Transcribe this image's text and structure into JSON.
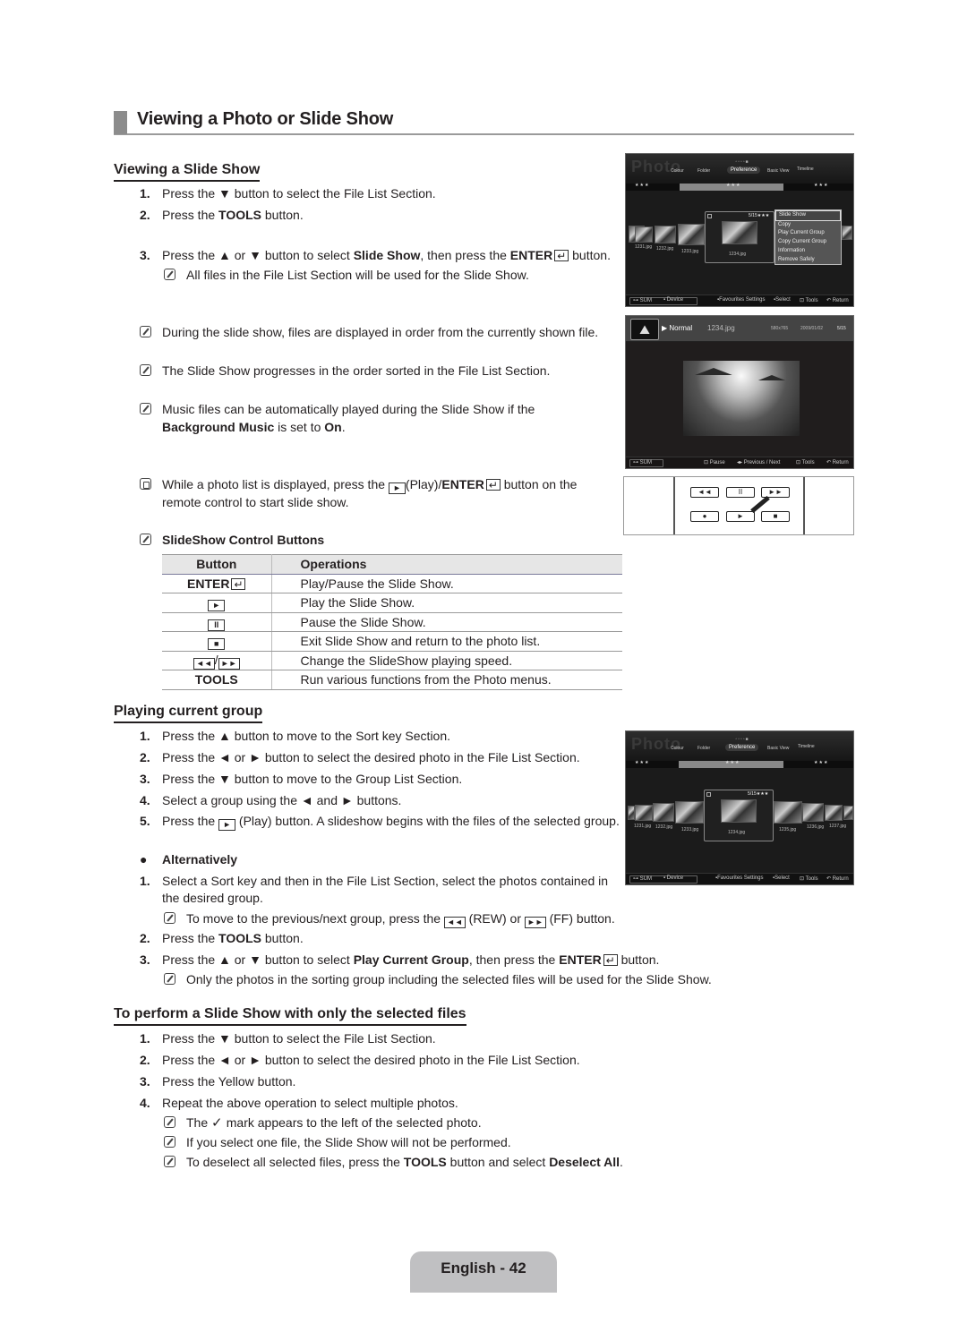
{
  "page_title": "Viewing a Photo or Slide Show",
  "sections": {
    "slideshow": {
      "heading": "Viewing a Slide Show",
      "steps": [
        {
          "num": "1.",
          "pre": "Press the ▼ button to select the File List Section."
        },
        {
          "num": "2.",
          "pre": "Press the ",
          "bold": "TOOLS",
          "post": " button."
        },
        {
          "num": "3.",
          "pre": "Press the ▲ or ▼ button to select ",
          "bold": "Slide Show",
          "mid": ", then press the ",
          "bold2": "ENTER",
          "post": " button."
        }
      ],
      "note_step3": "All files in the File List Section will be used for the Slide Show.",
      "notes": [
        "During the slide show, files are displayed in order from the currently shown file.",
        "The Slide Show progresses in the order sorted in the File List Section.",
        "Music files can be automatically played during the Slide Show if the"
      ],
      "note3_line2": {
        "bold1": "Background Music",
        "mid": " is set to ",
        "bold2": "On",
        "end": "."
      },
      "hand_note": {
        "pre": "While a photo list is displayed, press the ",
        "mid": "(Play)/",
        "bold": "ENTER",
        "post": " button on the",
        "line2": "remote control to start slide show."
      },
      "controls_heading": "SlideShow Control Buttons"
    },
    "controls_table": {
      "headers": [
        "Button",
        "Operations"
      ],
      "rows": [
        {
          "button": "ENTER",
          "button_icon": "enter-icon",
          "operation": "Play/Pause the Slide Show."
        },
        {
          "button": "►",
          "button_icon": "play-icon",
          "operation": "Play the Slide Show."
        },
        {
          "button": "II",
          "button_icon": "pause-icon",
          "operation": "Pause the Slide Show."
        },
        {
          "button": "■",
          "button_icon": "stop-icon",
          "operation": "Exit Slide Show and return to the photo list."
        },
        {
          "button": "◄◄/►►",
          "button_icon": "rew-ff-icon",
          "operation": "Change the SlideShow playing speed."
        },
        {
          "button": "TOOLS",
          "button_icon": "",
          "operation": "Run various functions from the Photo menus."
        }
      ]
    },
    "current_group": {
      "heading": "Playing current group",
      "steps": [
        {
          "num": "1.",
          "text": "Press the ▲ button to move to the Sort key Section."
        },
        {
          "num": "2.",
          "text": "Press the ◄ or ► button to select the desired photo in the File List Section."
        },
        {
          "num": "3.",
          "text": "Press the ▼ button to move to the Group List Section."
        },
        {
          "num": "4.",
          "text": "Select a group using the ◄ and ► buttons."
        },
        {
          "num": "5.",
          "pre": "Press the ",
          "post": " (Play) button. A slideshow begins with the files of the selected group."
        }
      ],
      "alt_heading": "Alternatively",
      "alt_steps": [
        {
          "num": "1.",
          "text": "Select a Sort key and then in the File List Section, select the photos contained in",
          "line2": "the desired group."
        },
        {
          "num": "2.",
          "pre": "Press the ",
          "bold": "TOOLS",
          "post": " button."
        },
        {
          "num": "3.",
          "pre": "Press the ▲ or ▼ button to select ",
          "bold": "Play Current Group",
          "mid": ", then press the ",
          "bold2": "ENTER",
          "post": " button."
        }
      ],
      "alt_note1": {
        "pre": "To move to the previous/next group, press the ",
        "mid": " (REW) or ",
        "post": " (FF) button."
      },
      "alt_note3": "Only the photos in the sorting group including the selected files will be used for the Slide Show."
    },
    "selected_files": {
      "heading": "To perform a Slide Show with only the selected files",
      "steps": [
        {
          "num": "1.",
          "text": "Press the ▼ button to select the File List Section."
        },
        {
          "num": "2.",
          "text": "Press the ◄ or ► button to select the desired photo in the File List Section."
        },
        {
          "num": "3.",
          "text": "Press the Yellow button."
        },
        {
          "num": "4.",
          "text": "Repeat the above operation to select multiple photos."
        }
      ],
      "notes": [
        {
          "pre": "The ",
          "post": " mark appears to the left of the selected photo."
        },
        {
          "text": "If you select one file, the Slide Show will not be performed."
        },
        {
          "pre": "To deselect all selected files, press the ",
          "bold": "TOOLS",
          "mid": " button and select ",
          "bold2": "Deselect All",
          "post": "."
        }
      ]
    }
  },
  "screens": {
    "photo_browser": {
      "logo": "Photo",
      "sort_keys": [
        "Colour",
        "Folder",
        "Preference",
        "Basic View",
        "Timeline"
      ],
      "selected_sort_key": "Preference",
      "group_stars": "★★★",
      "files": [
        "1231.jpg",
        "1232.jpg",
        "1233.jpg",
        "1234.jpg",
        "1235.jpg",
        "1236.jpg",
        "1237.jpg"
      ],
      "focus_counter_1": "5/15",
      "focus_counter_2": "5/15",
      "tools_menu": [
        "Slide Show",
        "Copy",
        "Play Current Group",
        "Copy Current Group",
        "Information",
        "Remove Safely"
      ],
      "tools_menu_selected": "Slide Show",
      "bottom": {
        "sum": "SUM",
        "device": "Device",
        "favourites": "Favourites Settings",
        "select": "Select",
        "tools": "Tools",
        "return": "Return"
      }
    },
    "slideshow_view": {
      "mode": "Normal",
      "filename": "1234.jpg",
      "resolution": "580x765",
      "date": "2009/01/02",
      "counter": "5/15",
      "bottom": {
        "sum": "SUM",
        "pause": "Pause",
        "prev_next": "Previous / Next",
        "tools": "Tools",
        "return": "Return"
      }
    },
    "remote": {
      "row1": [
        "◄◄",
        "II",
        "►►"
      ],
      "row2": [
        "●",
        "►",
        "■"
      ]
    }
  },
  "footer": {
    "page_label": "English - 42"
  }
}
